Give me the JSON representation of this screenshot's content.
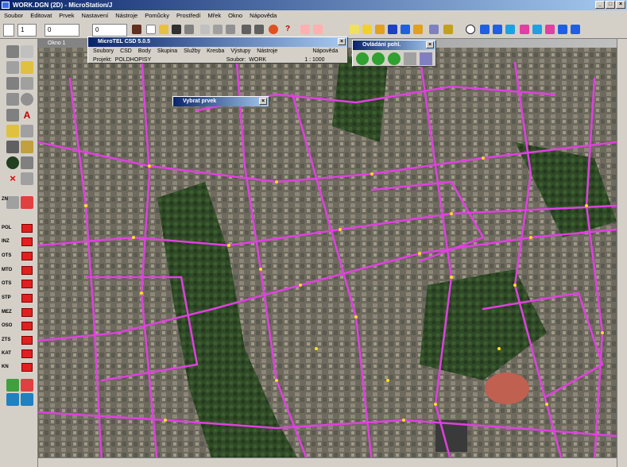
{
  "window": {
    "title": "WORK.DGN (2D) - MicroStation/J"
  },
  "menu": [
    "Soubor",
    "Editovat",
    "Prvek",
    "Nastavení",
    "Nástroje",
    "Pomůcky",
    "Prostředí",
    "Mřek",
    "Okno",
    "Nápověda"
  ],
  "toolbar": {
    "level": "1",
    "style_value": "0",
    "weight_value": "0"
  },
  "map_window": {
    "title": "Okno 1"
  },
  "side_labels": [
    "ZN",
    "POL",
    "INZ",
    "OTS",
    "MTO",
    "OTS",
    "STP",
    "MEZ",
    "OSO",
    "ZTS",
    "KAT",
    "KN"
  ],
  "csd_dialog": {
    "title": "MicroTEL CSD 5.0.5",
    "menu": [
      "Soubory",
      "CSD",
      "Body",
      "Skupina",
      "Služby",
      "Kresba",
      "Výstupy",
      "Nástroje",
      "Nápověda"
    ],
    "project_label": "Projekt:",
    "project_value": "POLDHOPISY",
    "file_label": "Soubor:",
    "file_value": "WORK",
    "scale": "1 : 1000"
  },
  "select_dialog": {
    "title": "Vybrat prvek"
  },
  "view_dialog": {
    "title": "Ovládání pohl."
  },
  "colors": {
    "streets": "#e040e0",
    "points": "#ffe020",
    "title_blue": "#0a246a"
  }
}
